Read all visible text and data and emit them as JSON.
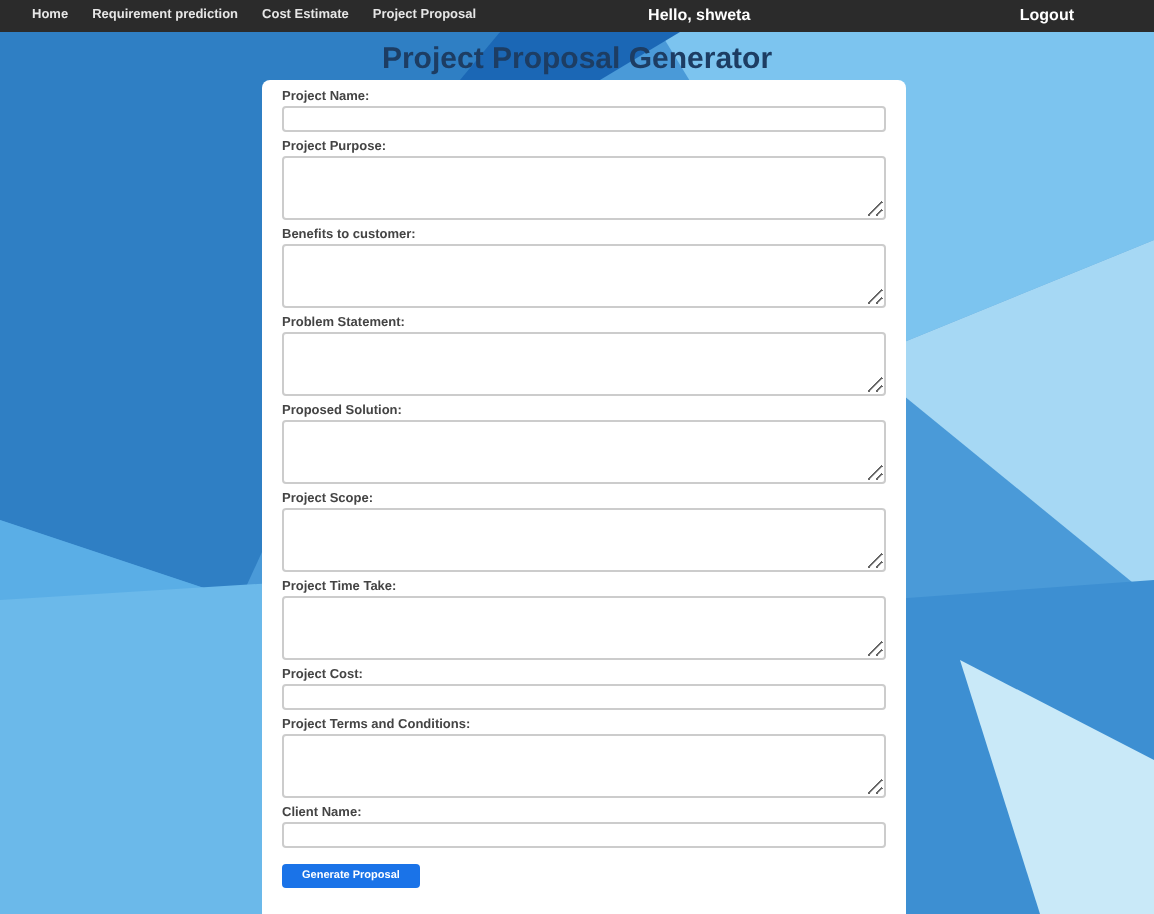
{
  "nav": {
    "links": [
      {
        "label": "Home"
      },
      {
        "label": "Requirement prediction"
      },
      {
        "label": "Cost Estimate"
      },
      {
        "label": "Project Proposal"
      }
    ],
    "greeting": "Hello, shweta",
    "logout": "Logout"
  },
  "title": "Project Proposal Generator",
  "form": {
    "fields": [
      {
        "label": "Project Name:",
        "kind": "input"
      },
      {
        "label": "Project Purpose:",
        "kind": "textarea"
      },
      {
        "label": "Benefits to customer:",
        "kind": "textarea"
      },
      {
        "label": "Problem Statement:",
        "kind": "textarea"
      },
      {
        "label": "Proposed Solution:",
        "kind": "textarea"
      },
      {
        "label": "Project Scope:",
        "kind": "textarea"
      },
      {
        "label": "Project Time Take:",
        "kind": "textarea"
      },
      {
        "label": "Project Cost:",
        "kind": "input"
      },
      {
        "label": "Project Terms and Conditions:",
        "kind": "textarea"
      },
      {
        "label": "Client Name:",
        "kind": "input"
      }
    ],
    "submit": "Generate Proposal"
  }
}
